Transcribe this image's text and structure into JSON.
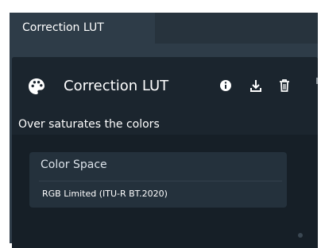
{
  "tab": {
    "label": "Correction LUT"
  },
  "card": {
    "title": "Correction LUT",
    "description": "Over saturates the colors",
    "color_space": {
      "label": "Color Space",
      "value": "RGB Limited (ITU-R BT.2020)"
    },
    "icons": {
      "main": "palette-icon",
      "info": "info-icon",
      "download": "download-icon",
      "delete": "trash-icon"
    }
  },
  "colors": {
    "panel_background": "#2e3c48",
    "card_background": "#161f27",
    "card_header_background": "#1b252e",
    "color_box_background": "#24313c",
    "text": "#ffffff"
  }
}
